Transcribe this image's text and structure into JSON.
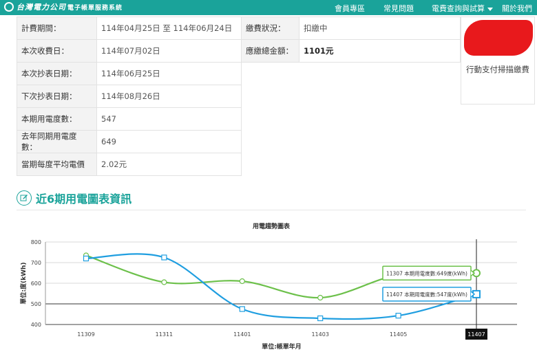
{
  "header": {
    "logo_main": "台灣電力公司",
    "logo_sub": "電子帳單服務系統",
    "nav": [
      "會員專區",
      "常見問題",
      "電費查詢與試算",
      "關於我們"
    ]
  },
  "bill": {
    "billing_period_label": "計費期間：",
    "billing_period_value": "114年04月25日 至 114年06月24日",
    "pay_status_label": "繳費狀況：",
    "pay_status_value": "扣繳中",
    "collect_date_label": "本次收費日：",
    "collect_date_value": "114年07月02日",
    "total_label": "應繳總金額：",
    "total_value": "1101元",
    "read_date_label": "本次抄表日期：",
    "read_date_value": "114年06月25日",
    "next_read_label": "下次抄表日期：",
    "next_read_value": "114年08月26日",
    "usage_label": "本期用電度數：",
    "usage_value": "547",
    "last_year_label": "去年同期用電度數：",
    "last_year_value": "649",
    "avg_price_label": "當期每度平均電價",
    "avg_price_value": "2.02元"
  },
  "side_panel": {
    "text": "行動支付掃描繳費",
    "redaction_color": "#e8191c"
  },
  "section": {
    "title": "近6期用電圖表資訊",
    "icon": "edit-icon"
  },
  "colors": {
    "brand": "#1aa39a",
    "series_current": "#1f9ee0",
    "series_last_year": "#6cc04a"
  },
  "chart_data": {
    "type": "line",
    "title": "用電趨勢圖表",
    "xlabel": "單位:帳單年月",
    "ylabel": "單位:度(kWh)",
    "categories": [
      "11309",
      "11311",
      "11401",
      "11403",
      "11405",
      "11407"
    ],
    "ylim": [
      400,
      800
    ],
    "yticks": [
      400,
      500,
      600,
      700,
      800
    ],
    "grid": true,
    "series": [
      {
        "values": [
          720,
          725,
          475,
          430,
          443,
          547
        ],
        "color": "#1f9ee0",
        "marker": "square"
      },
      {
        "values": [
          735,
          605,
          610,
          530,
          640,
          649
        ],
        "color": "#6cc04a",
        "marker": "circle"
      }
    ],
    "crosshair_category": "11407",
    "tooltips": [
      {
        "text": "11307 本期用電度數:649度(kWh)",
        "color": "#6cc04a"
      },
      {
        "text": "11407 本期用電度數:547度(kWh)",
        "color": "#1f9ee0"
      }
    ]
  }
}
